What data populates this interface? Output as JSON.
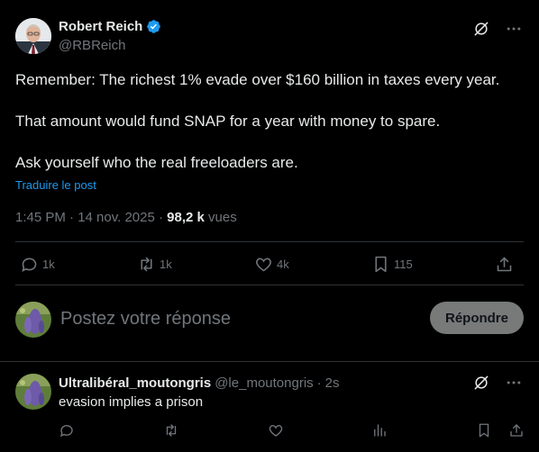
{
  "post": {
    "author_name": "Robert Reich",
    "author_handle": "@RBReich",
    "paragraphs": [
      "Remember: The richest 1% evade over $160 billion in taxes every year.",
      "That amount would fund SNAP for a year with money to spare.",
      "Ask yourself who the real freeloaders are."
    ],
    "translate_label": "Traduire le post",
    "time": "1:45 PM · 14 nov. 2025 · ",
    "views_count": "98,2 k",
    "views_label": " vues",
    "actions": {
      "replies": "1k",
      "reposts": "1k",
      "likes": "4k",
      "bookmarks": "115"
    }
  },
  "reply_box": {
    "placeholder": "Postez votre réponse",
    "button_label": "Répondre"
  },
  "comment": {
    "name": "Ultralibéral_moutongris",
    "handle": "@le_moutongris",
    "separator": "·",
    "time": "2s",
    "text": "evasion implies a prison"
  },
  "colors": {
    "background": "#000000",
    "text": "#e7e9ea",
    "muted": "#71767b",
    "link": "#1d9bf0",
    "verified": "#1d9bf0",
    "button_bg": "#787a7a",
    "divider": "#2f3336"
  }
}
